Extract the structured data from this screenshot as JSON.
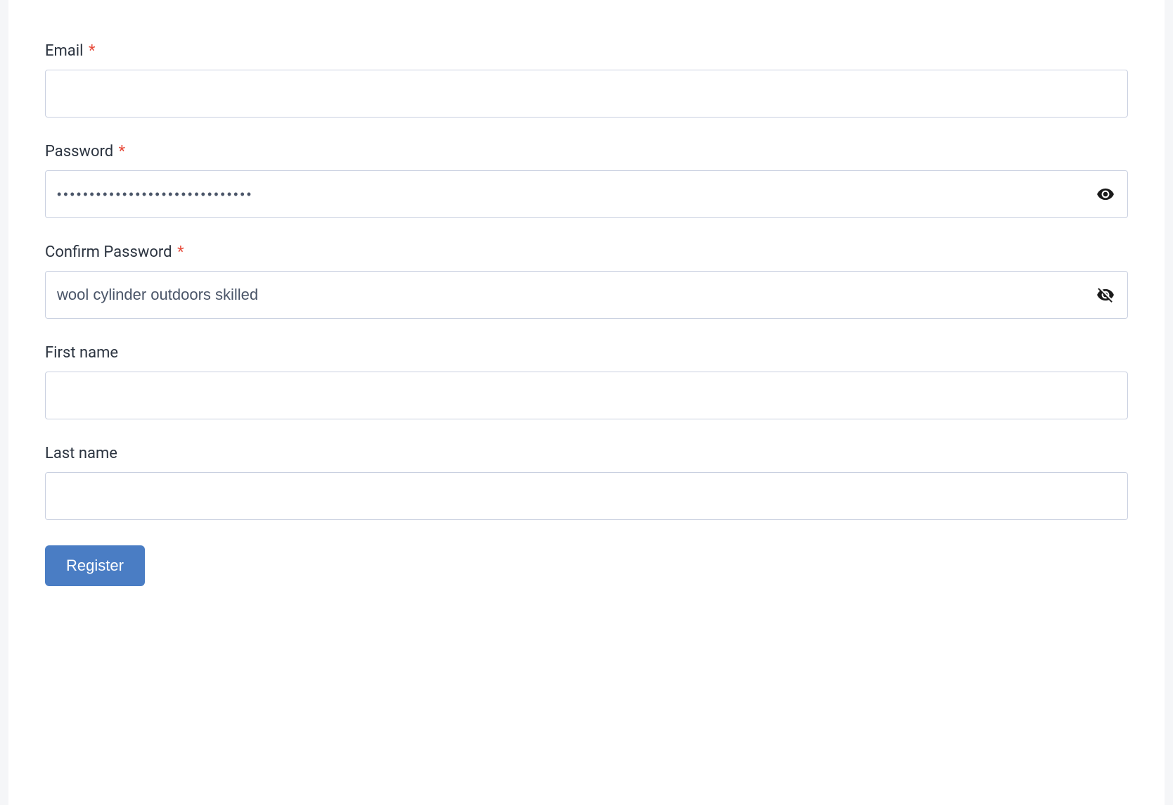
{
  "form": {
    "email": {
      "label": "Email",
      "required": true,
      "value": ""
    },
    "password": {
      "label": "Password",
      "required": true,
      "value": "wool cylinder outdoors skilled",
      "visible": false
    },
    "confirm_password": {
      "label": "Confirm Password",
      "required": true,
      "value": "wool cylinder outdoors skilled",
      "visible": true
    },
    "first_name": {
      "label": "First name",
      "required": false,
      "value": ""
    },
    "last_name": {
      "label": "Last name",
      "required": false,
      "value": ""
    },
    "submit_label": "Register"
  }
}
